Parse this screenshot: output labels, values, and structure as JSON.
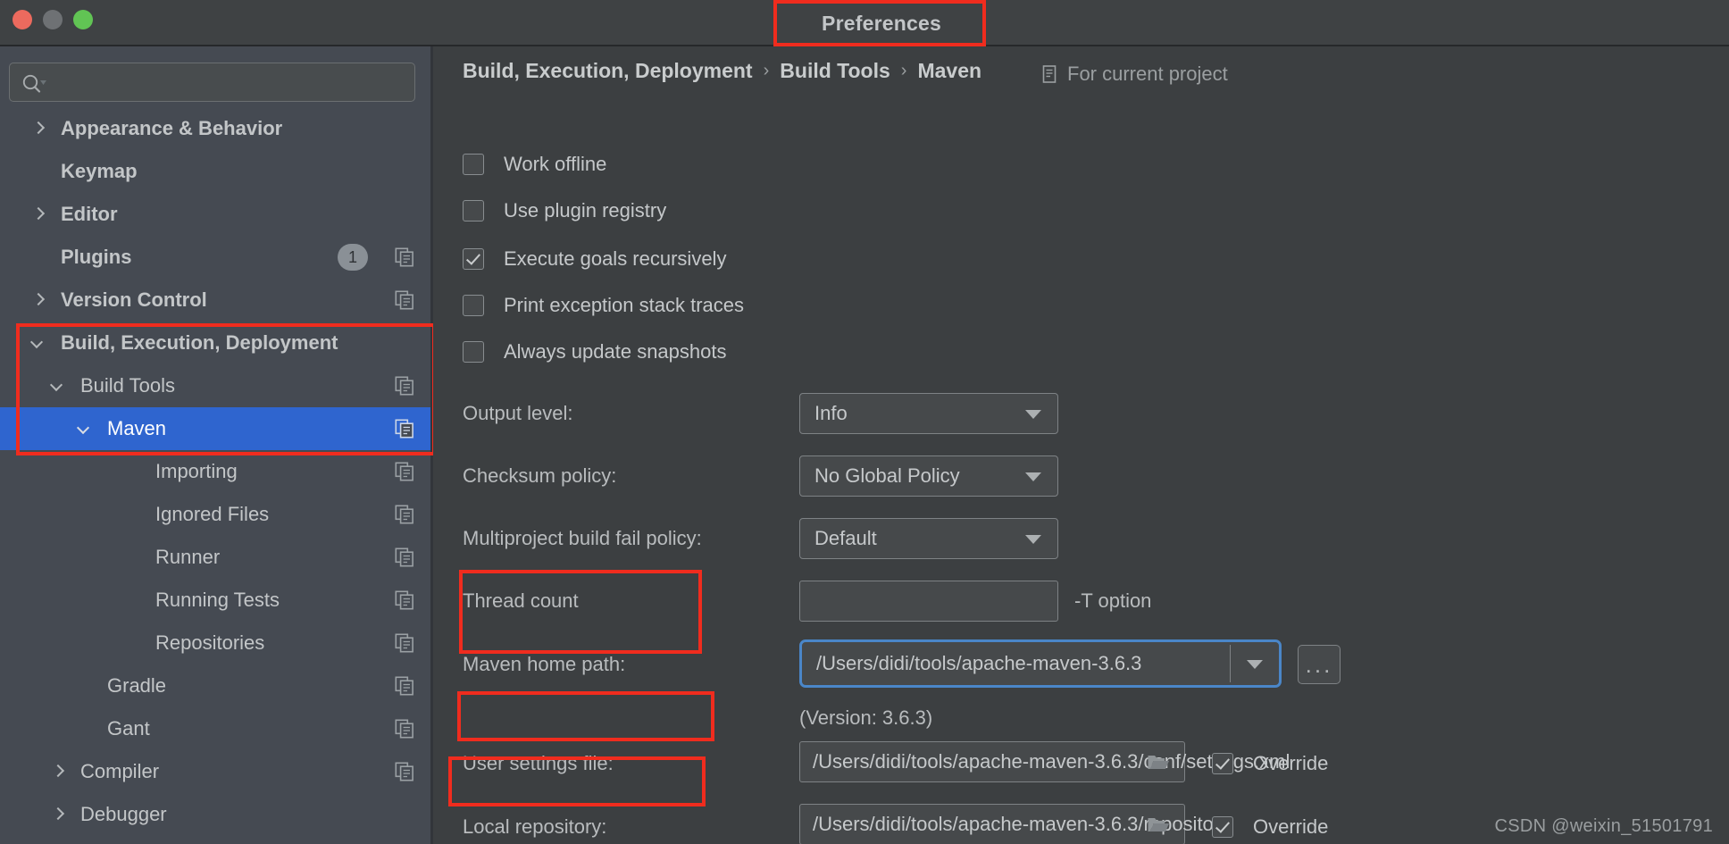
{
  "window": {
    "title": "Preferences",
    "traffic_lights": [
      "close",
      "minimize",
      "zoom"
    ]
  },
  "sidebar": {
    "search": {
      "value": "",
      "placeholder": "",
      "icon": "search-icon"
    },
    "items": [
      {
        "label": "Appearance & Behavior",
        "arrow": "right",
        "indent": 0,
        "bold": true,
        "selected": false,
        "badge": null,
        "copy_icon": false
      },
      {
        "label": "Keymap",
        "arrow": "none",
        "indent": 0,
        "bold": true,
        "selected": false,
        "badge": null,
        "copy_icon": false
      },
      {
        "label": "Editor",
        "arrow": "right",
        "indent": 0,
        "bold": true,
        "selected": false,
        "badge": null,
        "copy_icon": false
      },
      {
        "label": "Plugins",
        "arrow": "none",
        "indent": 0,
        "bold": true,
        "selected": false,
        "badge": "1",
        "copy_icon": true
      },
      {
        "label": "Version Control",
        "arrow": "right",
        "indent": 0,
        "bold": true,
        "selected": false,
        "badge": null,
        "copy_icon": true
      },
      {
        "label": "Build, Execution, Deployment",
        "arrow": "down",
        "indent": 0,
        "bold": true,
        "selected": false,
        "badge": null,
        "copy_icon": false
      },
      {
        "label": "Build Tools",
        "arrow": "down",
        "indent": 1,
        "bold": false,
        "selected": false,
        "badge": null,
        "copy_icon": true
      },
      {
        "label": "Maven",
        "arrow": "down",
        "indent": 2,
        "bold": false,
        "selected": true,
        "badge": null,
        "copy_icon": true
      },
      {
        "label": "Importing",
        "arrow": "none",
        "indent": 3,
        "bold": false,
        "selected": false,
        "badge": null,
        "copy_icon": true
      },
      {
        "label": "Ignored Files",
        "arrow": "none",
        "indent": 3,
        "bold": false,
        "selected": false,
        "badge": null,
        "copy_icon": true
      },
      {
        "label": "Runner",
        "arrow": "none",
        "indent": 3,
        "bold": false,
        "selected": false,
        "badge": null,
        "copy_icon": true
      },
      {
        "label": "Running Tests",
        "arrow": "none",
        "indent": 3,
        "bold": false,
        "selected": false,
        "badge": null,
        "copy_icon": true
      },
      {
        "label": "Repositories",
        "arrow": "none",
        "indent": 3,
        "bold": false,
        "selected": false,
        "badge": null,
        "copy_icon": true
      },
      {
        "label": "Gradle",
        "arrow": "none",
        "indent": 2,
        "bold": false,
        "selected": false,
        "badge": null,
        "copy_icon": true
      },
      {
        "label": "Gant",
        "arrow": "none",
        "indent": 2,
        "bold": false,
        "selected": false,
        "badge": null,
        "copy_icon": true
      },
      {
        "label": "Compiler",
        "arrow": "right",
        "indent": 1,
        "bold": false,
        "selected": false,
        "badge": null,
        "copy_icon": true
      },
      {
        "label": "Debugger",
        "arrow": "right",
        "indent": 1,
        "bold": false,
        "selected": false,
        "badge": null,
        "copy_icon": false
      }
    ]
  },
  "content": {
    "breadcrumb": {
      "part1": "Build, Execution, Deployment",
      "sep1": "›",
      "part2": "Build Tools",
      "sep2": "›",
      "part3": "Maven"
    },
    "scope": {
      "label": "For current project",
      "icon": "project-scope-icon"
    },
    "checkboxes": [
      {
        "label": "Work offline",
        "checked": false
      },
      {
        "label": "Use plugin registry",
        "checked": false
      },
      {
        "label": "Execute goals recursively",
        "checked": true
      },
      {
        "label": "Print exception stack traces",
        "checked": false
      },
      {
        "label": "Always update snapshots",
        "checked": false
      }
    ],
    "output_level": {
      "label": "Output level:",
      "value": "Info"
    },
    "checksum_policy": {
      "label": "Checksum policy:",
      "value": "No Global Policy"
    },
    "multiproject_policy": {
      "label": "Multiproject build fail policy:",
      "value": "Default"
    },
    "thread_count": {
      "label": "Thread count",
      "value": "",
      "hint": "-T option"
    },
    "maven_home": {
      "label": "Maven home path:",
      "value": "/Users/didi/tools/apache-maven-3.6.3",
      "version_note": "(Version: 3.6.3)",
      "browse_label": "..."
    },
    "user_settings": {
      "label": "User settings file:",
      "value": "/Users/didi/tools/apache-maven-3.6.3/conf/settings.xml",
      "override_label": "Override",
      "override_checked": true
    },
    "local_repository": {
      "label": "Local repository:",
      "value": "/Users/didi/tools/apache-maven-3.6.3/repository",
      "override_label": "Override",
      "override_checked": true
    }
  },
  "watermark": "CSDN @weixin_51501791",
  "colors": {
    "highlight_red": "#f02c1e",
    "selection_blue": "#2f65cf",
    "focus_blue": "#4a86c8",
    "titlebar_bg": "#3f4244",
    "sidebar_bg": "#454a52",
    "content_bg": "#3c3f41"
  }
}
